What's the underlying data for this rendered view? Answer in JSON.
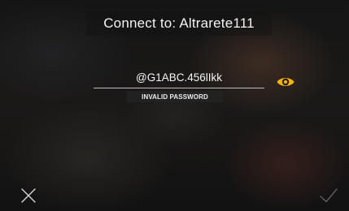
{
  "dialog": {
    "title": "Connect to: Altrarete111"
  },
  "password_field": {
    "value": "@G1ABC.456lIkk",
    "error_message": "INVALID PASSWORD",
    "visibility_toggle_icon": "eye-icon",
    "visibility_toggle_color": "#f5b400"
  },
  "actions": {
    "cancel_icon": "close-icon",
    "confirm_icon": "checkmark-icon"
  }
}
